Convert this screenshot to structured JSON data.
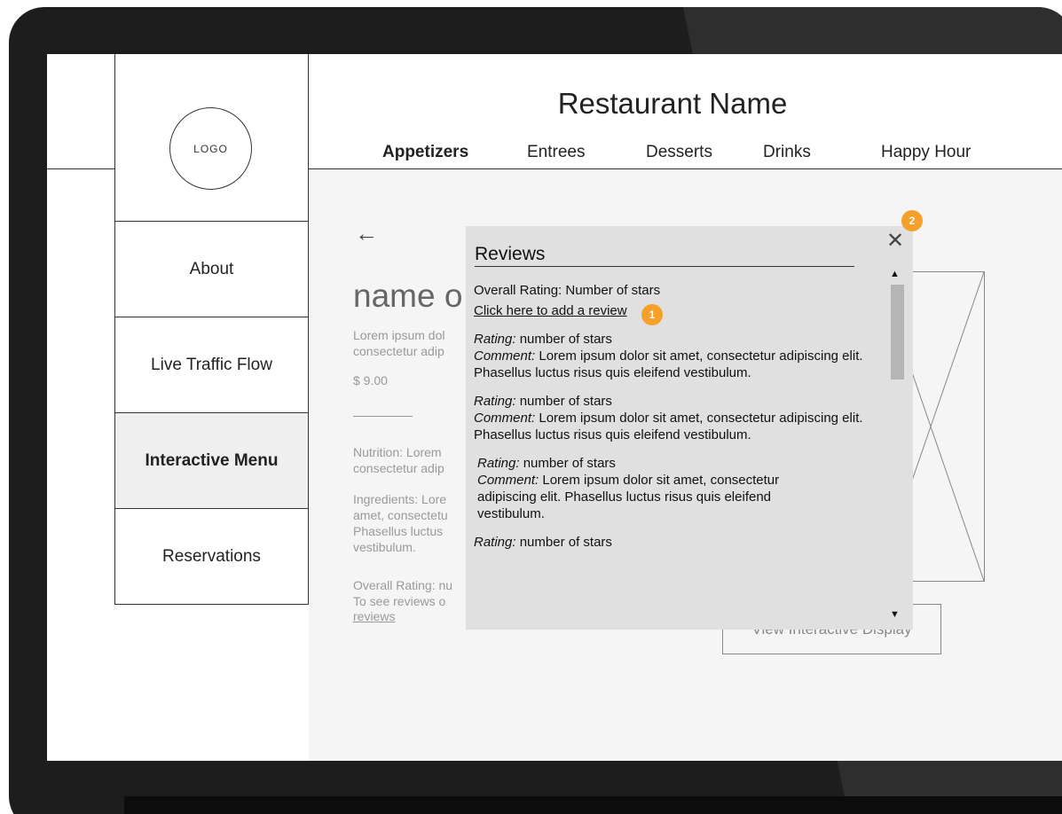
{
  "header": {
    "restaurant_name": "Restaurant Name",
    "tabs": [
      "Appetizers",
      "Entrees",
      "Desserts",
      "Drinks",
      "Happy Hour"
    ],
    "active_tab": "Appetizers"
  },
  "sidebar": {
    "logo_text": "LOGO",
    "items": [
      {
        "label": "About"
      },
      {
        "label": "Live Traffic Flow"
      },
      {
        "label": "Interactive Menu",
        "active": true
      },
      {
        "label": "Reservations"
      }
    ]
  },
  "content": {
    "back_icon": "left-arrow-icon",
    "item_name": "name o",
    "description": "Lorem ipsum dol consectetur adip",
    "price": "$ 9.00",
    "nutrition": "Nutrition: Lorem consectetur adip",
    "ingredients": "Ingredients: Lore amet, consectetu Phasellus luctus vestibulum.",
    "overall_rating": "Overall Rating: nu To see reviews o",
    "reviews_link": "reviews",
    "display_button": "View Interactive Display"
  },
  "modal": {
    "title": "Reviews",
    "overall_rating": "Overall Rating: Number of stars",
    "add_review_link": "Click here to add a review",
    "close_icon": "close-icon",
    "reviews": [
      {
        "rating_label": "Rating:",
        "rating": "number of stars",
        "comment_label": "Comment:",
        "comment": "Lorem ipsum dolor sit amet, consectetur adipiscing elit. Phasellus luctus risus quis eleifend vestibulum."
      },
      {
        "rating_label": "Rating:",
        "rating": "number of stars",
        "comment_label": "Comment:",
        "comment": "Lorem ipsum dolor sit amet, consectetur adipiscing elit. Phasellus luctus risus quis eleifend vestibulum."
      },
      {
        "rating_label": "Rating:",
        "rating": "number of stars",
        "comment_label": "Comment:",
        "comment": "Lorem ipsum dolor sit amet, consectetur adipiscing elit. Phasellus luctus risus quis eleifend vestibulum."
      },
      {
        "rating_label": "Rating:",
        "rating": "number of stars",
        "comment_label": "",
        "comment": ""
      }
    ],
    "scroll_up_icon": "scroll-up-arrow-icon",
    "scroll_down_icon": "scroll-down-arrow-icon"
  },
  "annotations": {
    "badge_1": "1",
    "badge_2": "2",
    "badge_color": "#f5a02a"
  }
}
